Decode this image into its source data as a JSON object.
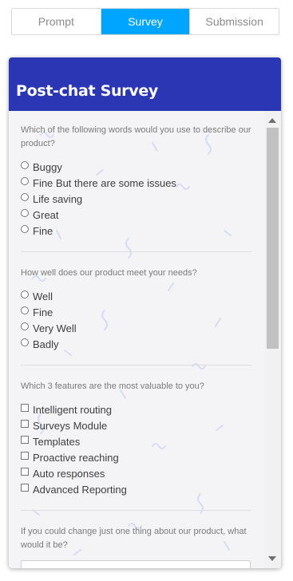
{
  "tabs": [
    {
      "label": "Prompt",
      "active": false
    },
    {
      "label": "Survey",
      "active": true
    },
    {
      "label": "Submission",
      "active": false
    }
  ],
  "survey": {
    "title": "Post-chat Survey",
    "q1": {
      "text": "Which of the following words would you use to describe our product?",
      "options": [
        "Buggy",
        "Fine But there are some issues",
        "Life saving",
        "Great",
        "Fine"
      ]
    },
    "q2": {
      "text": "How well does our product meet your needs?",
      "options": [
        "Well",
        "Fine",
        "Very Well",
        "Badly"
      ]
    },
    "q3": {
      "text": "Which 3 features are the most valuable to you?",
      "options": [
        "Intelligent routing",
        "Surveys Module",
        "Templates",
        "Proactive reaching",
        "Auto responses",
        "Advanced Reporting"
      ]
    },
    "q4": {
      "text": "If you could change just one thing about our product, what would it be?",
      "value": ""
    }
  },
  "colors": {
    "header": "#2b36b5",
    "active_tab": "#00a5ff"
  }
}
